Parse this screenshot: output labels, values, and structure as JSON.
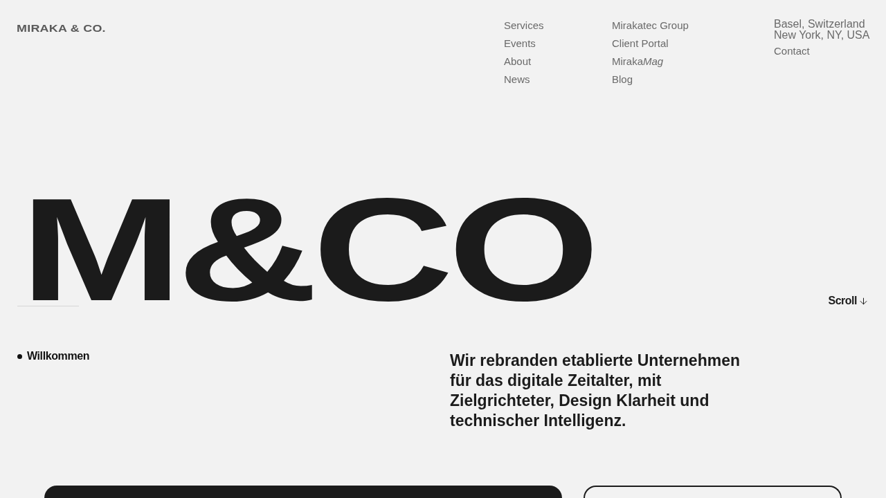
{
  "header": {
    "logo": "MIRAKA & CO.",
    "nav_columns": [
      [
        {
          "text": "Services"
        },
        {
          "text": "Events"
        },
        {
          "text": "About"
        },
        {
          "text": "News"
        }
      ],
      [
        {
          "text": "Mirakatec Group"
        },
        {
          "text": "Client Portal"
        },
        {
          "text": "Miraka",
          "italic_suffix": "Mag"
        },
        {
          "text": "Blog"
        }
      ]
    ],
    "locations": [
      "Basel, Switzerland",
      "New York, NY, USA"
    ],
    "contact": "Contact"
  },
  "hero": {
    "wordmark": "M&CO",
    "scroll": "Scroll"
  },
  "intro": {
    "label": "Willkommen",
    "statement": "Wir rebranden etablierte Unternehmen für das digitale Zeitalter, mit Zielgrichteter, Design Klarheit und technischer Intelligenz."
  }
}
